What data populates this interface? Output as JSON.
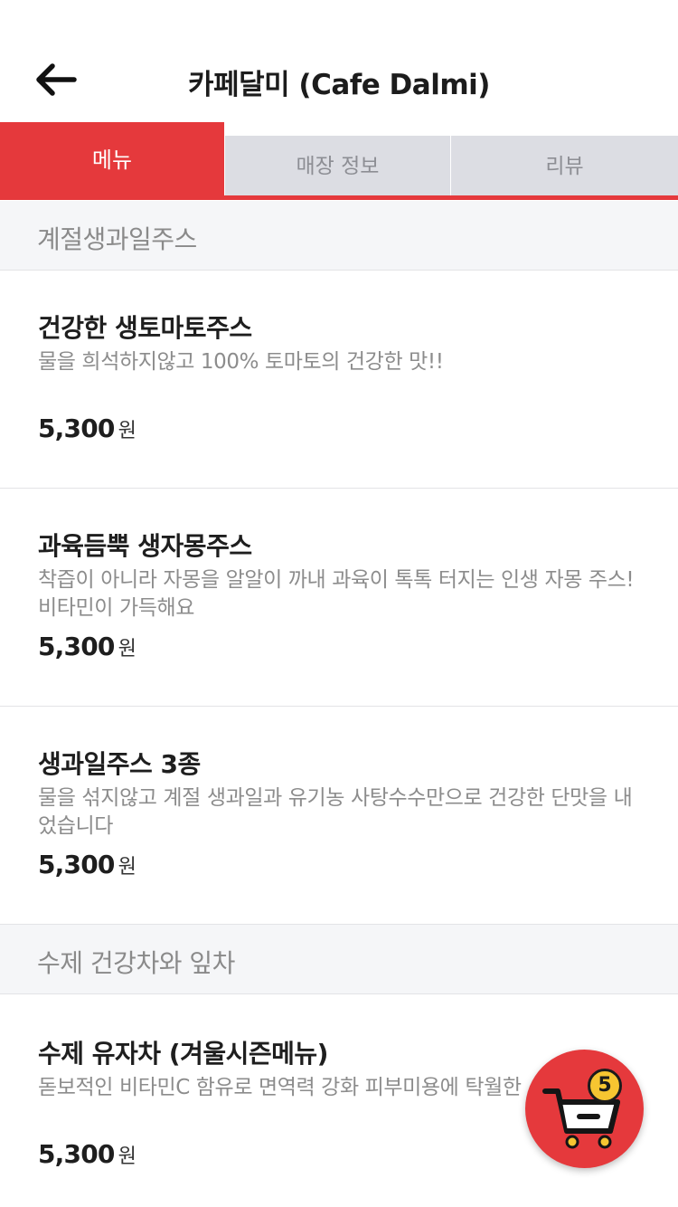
{
  "header": {
    "title": "카페달미 (Cafe Dalmi)",
    "back_icon": "arrow-left-icon"
  },
  "tabs": [
    {
      "label": "메뉴",
      "active": true
    },
    {
      "label": "매장 정보",
      "active": false
    },
    {
      "label": "리뷰",
      "active": false
    }
  ],
  "sections": [
    {
      "title": "계절생과일주스",
      "items": [
        {
          "name": "건강한 생토마토주스",
          "desc": "물을 희석하지않고 100% 토마토의 건강한 맛!!",
          "price": "5,300",
          "unit": "원"
        },
        {
          "name": "과육듬뿍 생자몽주스",
          "desc": "착즙이 아니라 자몽을 알알이 까내 과육이 톡톡 터지는 인생 자몽 주스! 비타민이 가득해요",
          "price": "5,300",
          "unit": "원"
        },
        {
          "name": "생과일주스 3종",
          "desc": "물을 섞지않고 계절 생과일과 유기농 사탕수수만으로 건강한 단맛을 내었습니다",
          "price": "5,300",
          "unit": "원"
        }
      ]
    },
    {
      "title": "수제 건강차와 잎차",
      "items": [
        {
          "name": "수제 유자차 (겨울시즌메뉴)",
          "desc": "돋보적인 비타민C 함유로 면역력 강화 피부미용에 탁월한",
          "price": "5,300",
          "unit": "원"
        }
      ]
    }
  ],
  "cart": {
    "count": "5",
    "icon": "shopping-cart-icon"
  },
  "colors": {
    "accent": "#e5393c",
    "tab_inactive": "#dcdde3",
    "badge": "#f6c531"
  }
}
